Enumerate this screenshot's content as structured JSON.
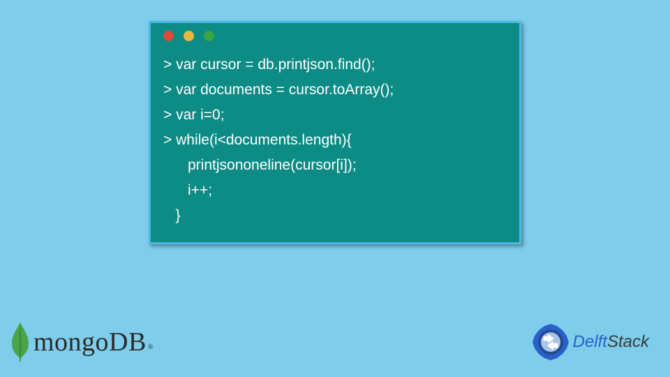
{
  "code": {
    "lines": [
      "> var cursor = db.printjson.find();",
      "> var documents = cursor.toArray();",
      "> var i=0;",
      "> while(i<documents.length){",
      "      printjsononeline(cursor[i]);",
      "      i++;",
      "   }"
    ]
  },
  "window": {
    "dot_colors": {
      "red": "#d94b3a",
      "yellow": "#e8b93e",
      "green": "#3aa545"
    }
  },
  "mongo": {
    "text": "mongoDB",
    "registered": "®"
  },
  "delft": {
    "part1": "Delft",
    "part2": "Stack"
  }
}
